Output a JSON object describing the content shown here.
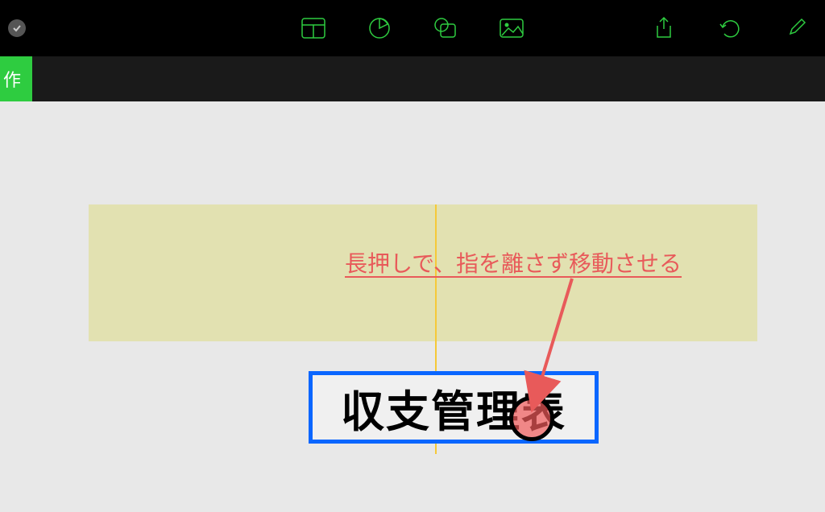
{
  "tag_label": "作",
  "annotation_text": "長押しで、指を離さず移動させる",
  "title_text": "収支管理表",
  "colors": {
    "accent_green": "#2ecc40",
    "blue_select": "#0a66ff",
    "annotation_red": "#e85a5a",
    "yellow_shape": "#e2e1b1",
    "guide_yellow": "#f5c938"
  },
  "icons": {
    "table": "table-icon",
    "pie": "pie-chart-icon",
    "shape": "shape-icon",
    "image": "image-icon",
    "share": "share-icon",
    "undo": "undo-icon",
    "brush": "brush-icon"
  }
}
